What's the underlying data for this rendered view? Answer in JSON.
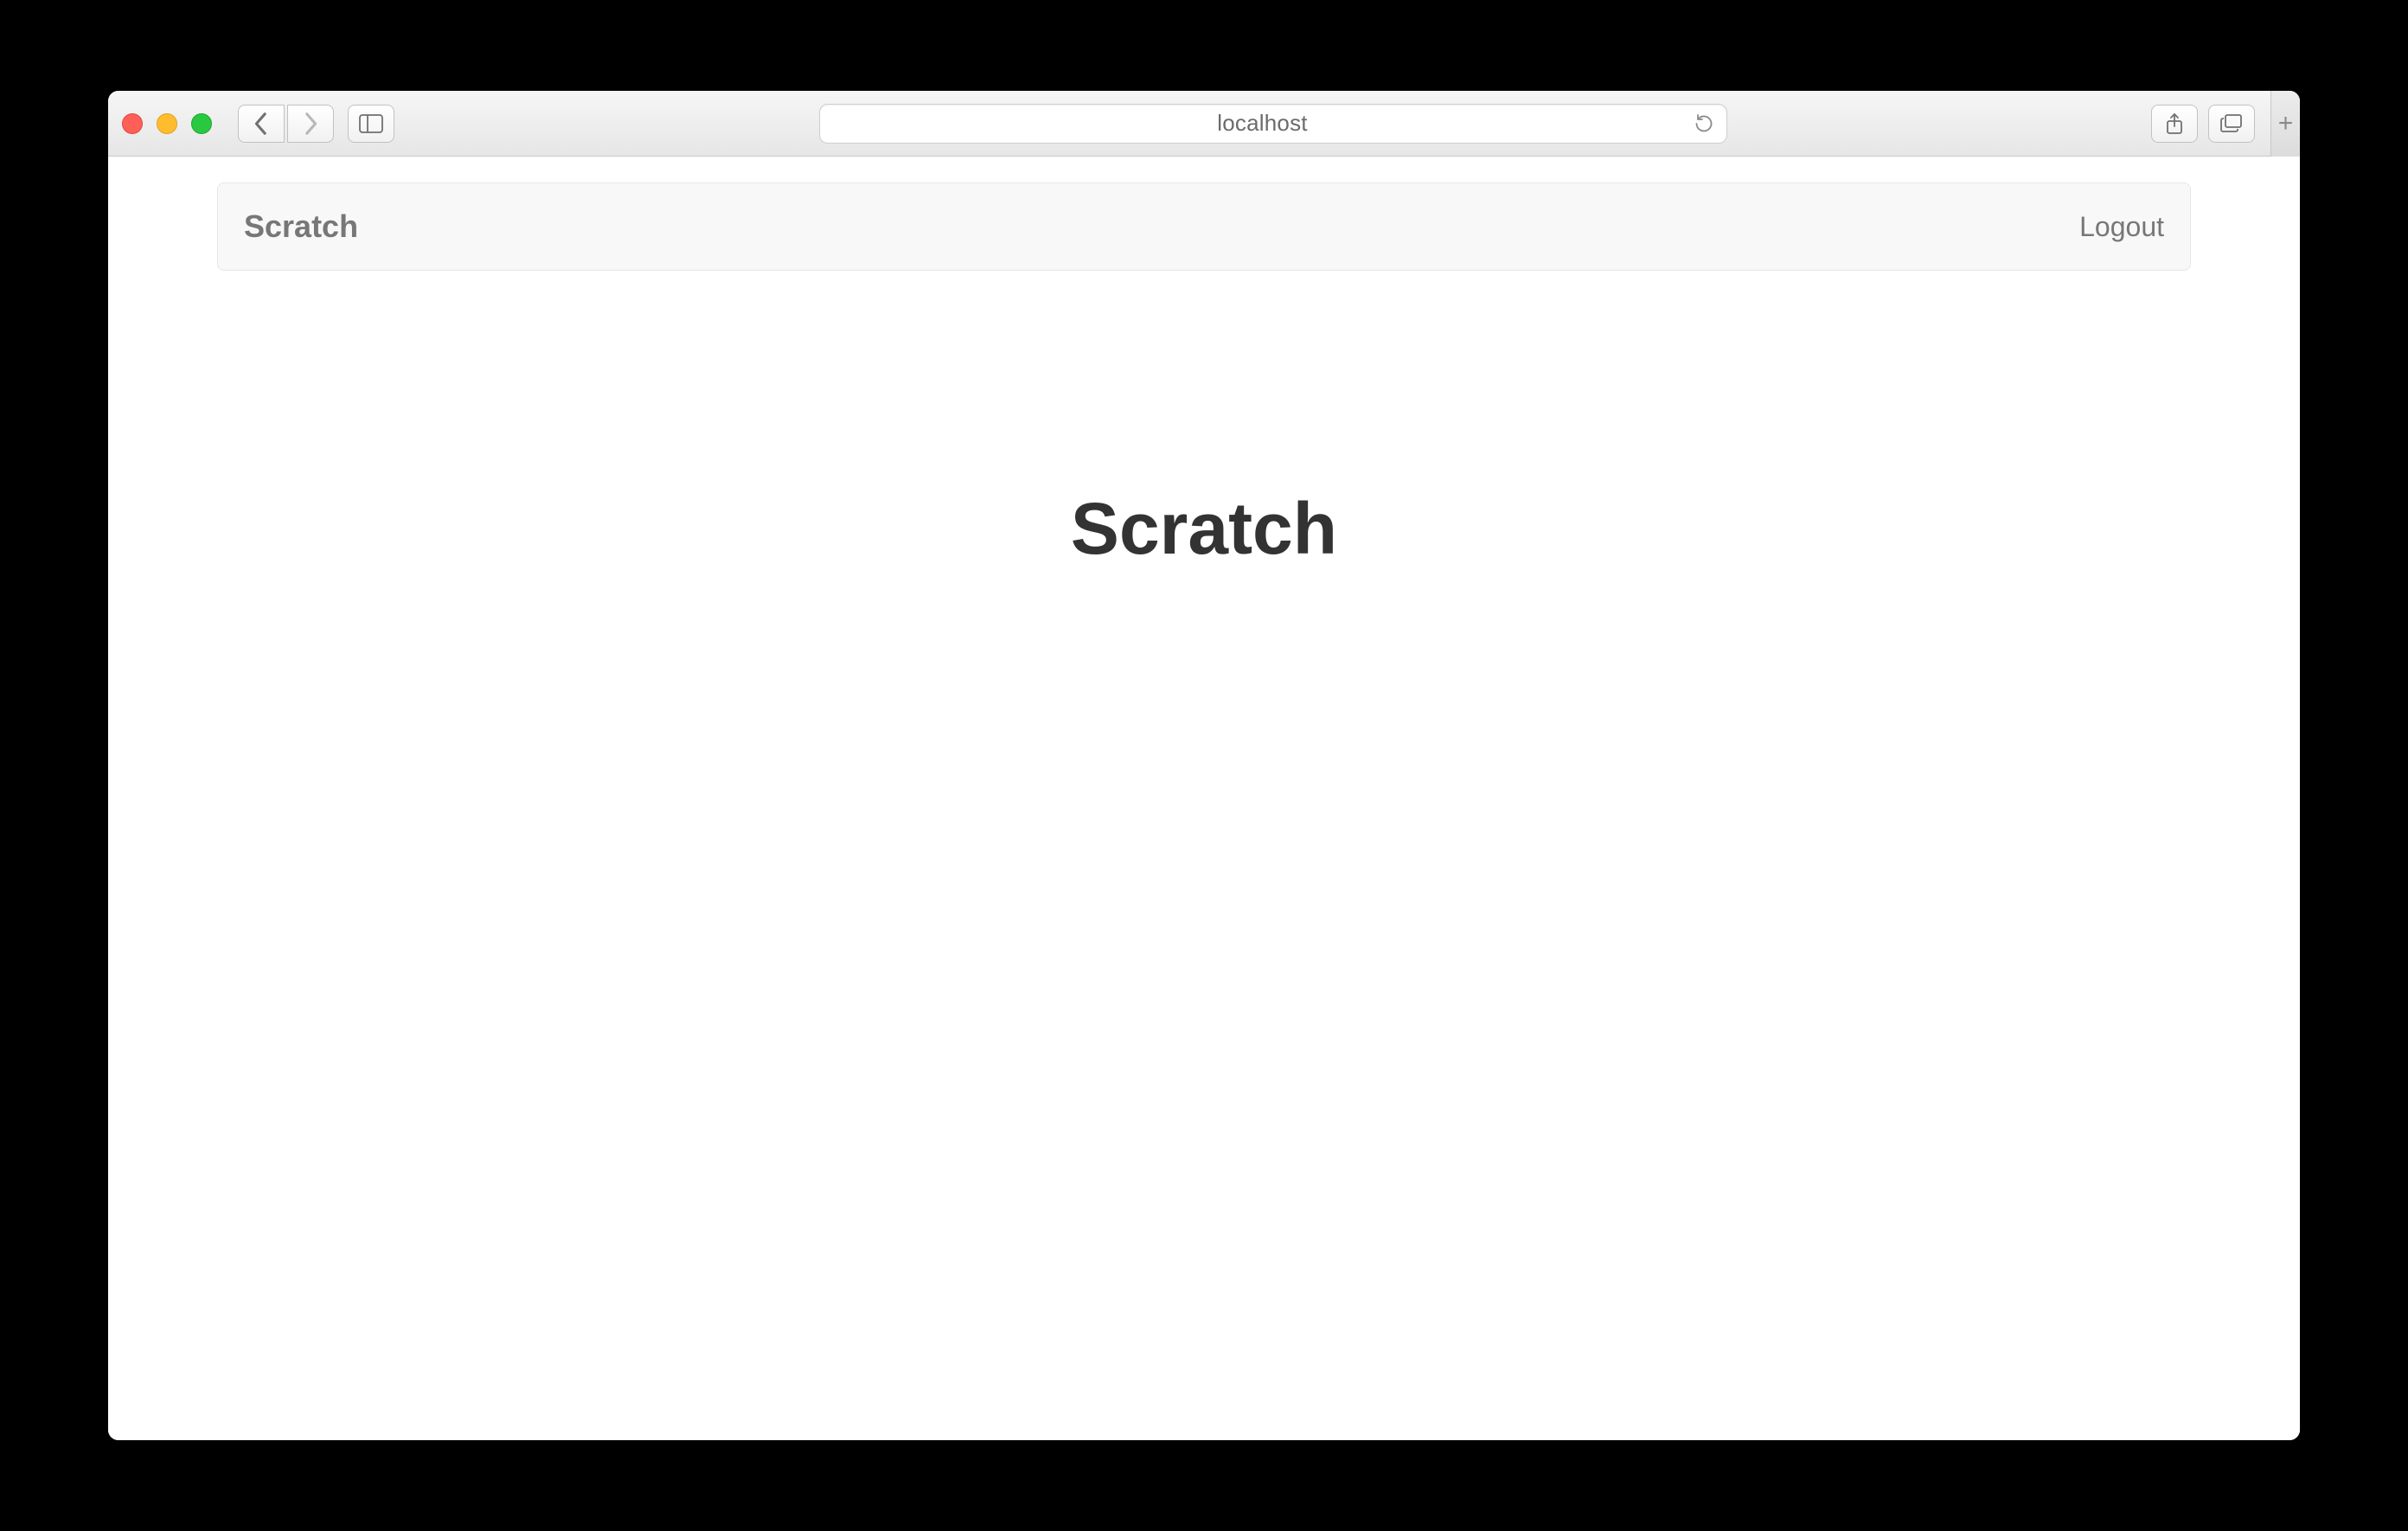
{
  "browser": {
    "address_text": "localhost"
  },
  "navbar": {
    "brand": "Scratch",
    "logout_label": "Logout"
  },
  "main": {
    "title": "Scratch"
  }
}
